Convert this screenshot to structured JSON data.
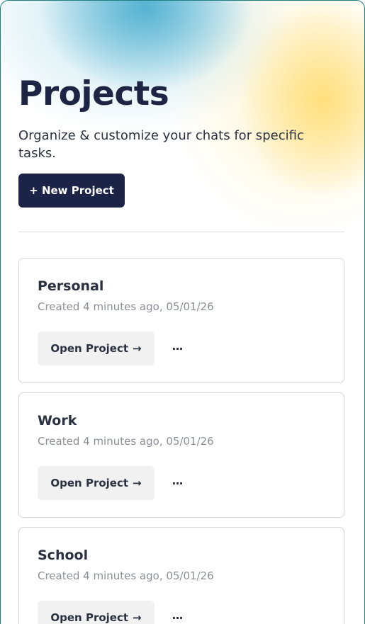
{
  "header": {
    "title": "Projects",
    "subtitle": "Organize & customize your chats for specific tasks."
  },
  "actions": {
    "new_project_label": "+ New Project"
  },
  "projects": [
    {
      "name": "Personal",
      "created": "Created 4 minutes ago, 05/01/26",
      "open_label": "Open Project",
      "arrow": "→",
      "more": "···"
    },
    {
      "name": "Work",
      "created": "Created 4 minutes ago, 05/01/26",
      "open_label": "Open Project",
      "arrow": "→",
      "more": "···"
    },
    {
      "name": "School",
      "created": "Created 4 minutes ago, 05/01/26",
      "open_label": "Open Project",
      "arrow": "→",
      "more": "···"
    }
  ],
  "colors": {
    "primary": "#1b2347",
    "title": "#1e2443",
    "muted": "#8b8f98",
    "accent_blue": "#41aacd",
    "accent_yellow": "#ffde78"
  }
}
